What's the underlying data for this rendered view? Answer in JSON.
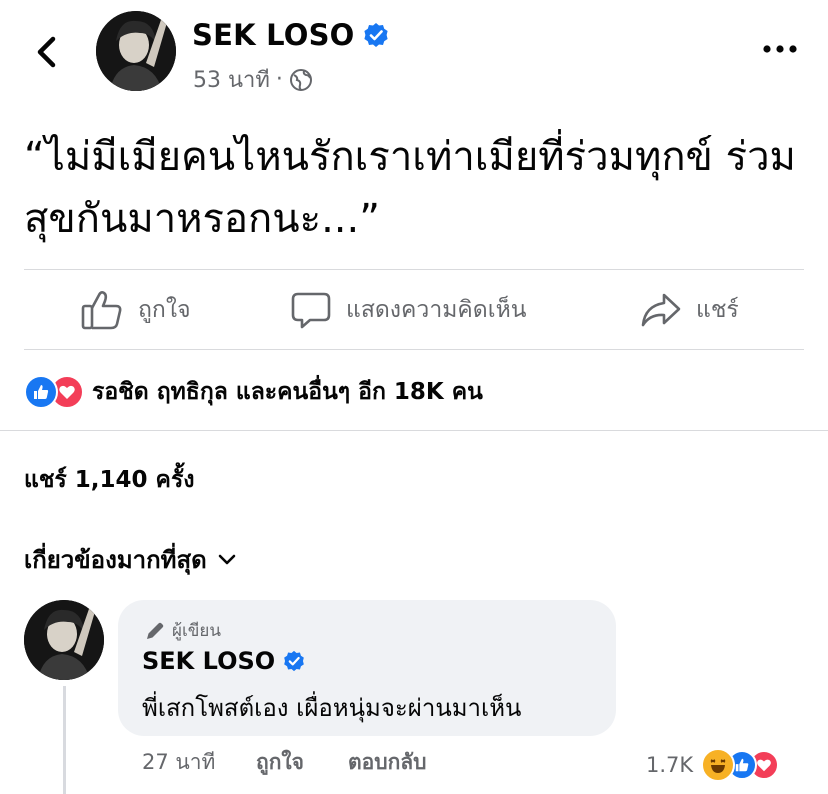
{
  "header": {
    "author_name": "SEK LOSO",
    "time": "53 นาที",
    "separator": "·",
    "icons": [
      "back-chevron-icon",
      "verified-badge-icon",
      "globe-icon",
      "more-options-icon"
    ]
  },
  "post": {
    "text": "“ไม่มีเมียคนไหนรักเราเท่าเมียที่ร่วมทุกข์ ร่วมสุขกันมาหรอกนะ...”"
  },
  "actions": {
    "like_label": "ถูกใจ",
    "comment_label": "แสดงความคิดเห็น",
    "share_label": "แชร์"
  },
  "reactions": {
    "summary": "รอชิด ฤทธิกุล และคนอื่นๆ อีก 18K คน",
    "types": [
      "like",
      "love"
    ]
  },
  "shares": {
    "text": "แชร์ 1,140 ครั้ง"
  },
  "sort": {
    "label": "เกี่ยวข้องมากที่สุด"
  },
  "comment": {
    "badge_label": "ผู้เขียน",
    "author_name": "SEK LOSO",
    "text": "พี่เสกโพสต์เอง เผื่อหนุ่มจะผ่านมาเห็น",
    "time": "27 นาที",
    "like_label": "ถูกใจ",
    "reply_label": "ตอบกลับ",
    "reaction_count": "1.7K",
    "reaction_types": [
      "haha",
      "like",
      "love"
    ]
  },
  "colors": {
    "facebook_blue": "#1877f2",
    "love_red": "#f33e58",
    "haha_yellow": "#f7b125",
    "secondary_text": "#65676b",
    "bubble_bg": "#f0f2f5"
  }
}
